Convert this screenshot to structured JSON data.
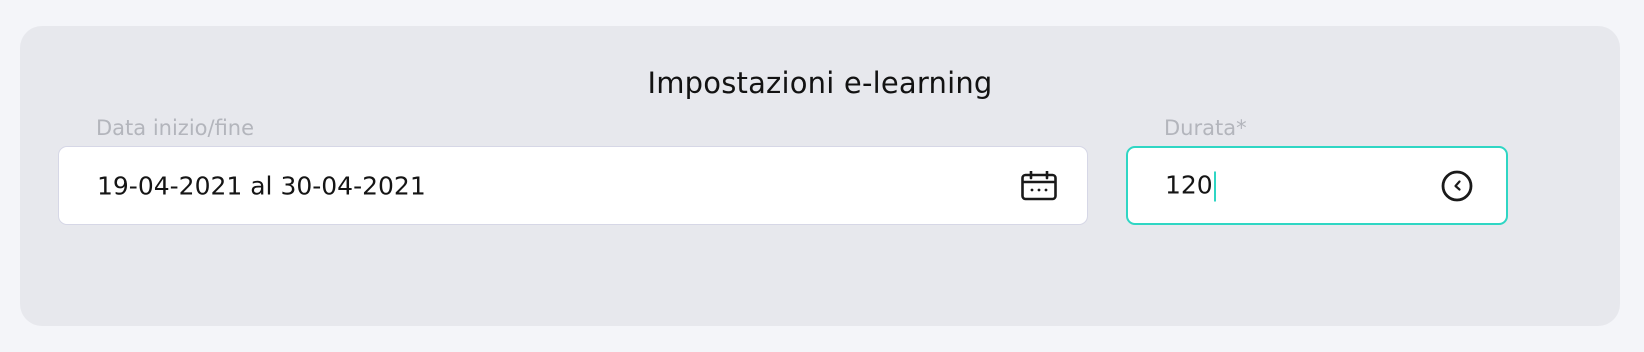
{
  "panel": {
    "title": "Impostazioni e-learning"
  },
  "date_field": {
    "label": "Data inizio/fine",
    "value": "19-04-2021 al 30-04-2021",
    "icon": "calendar-icon"
  },
  "duration_field": {
    "label": "Durata*",
    "value": "120",
    "icon": "clock-icon",
    "focused": true
  },
  "colors": {
    "page_bg": "#f4f5f9",
    "panel_bg": "#e7e8ed",
    "focus_accent": "#2fd6c4",
    "label_text": "#b3b5bc",
    "value_text": "#151515"
  }
}
